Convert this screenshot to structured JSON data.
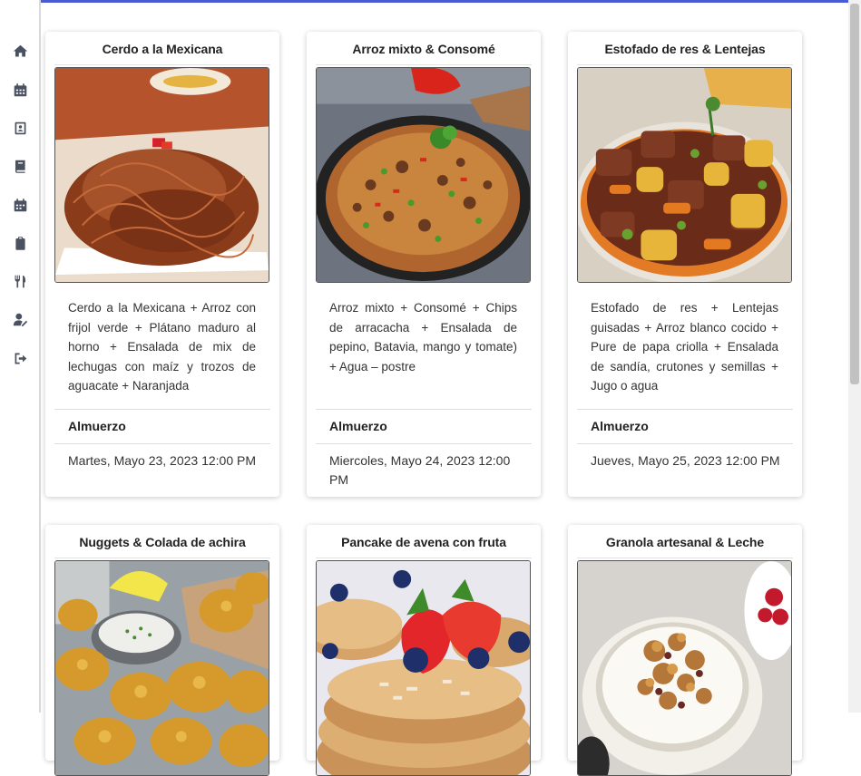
{
  "sidebar": {
    "items": [
      {
        "name": "home-icon"
      },
      {
        "name": "calendar-icon"
      },
      {
        "name": "contact-book-icon"
      },
      {
        "name": "book-icon"
      },
      {
        "name": "calendar-alt-icon"
      },
      {
        "name": "clipboard-icon"
      },
      {
        "name": "utensils-icon"
      },
      {
        "name": "user-edit-icon"
      },
      {
        "name": "sign-out-icon"
      }
    ]
  },
  "colors": {
    "accent": "#4a5bd6",
    "icon": "#4a5160"
  },
  "cards": [
    {
      "title": "Cerdo a la Mexicana",
      "image": "shredded-pork-dish",
      "description": "Cerdo a la Mexicana + Arroz con frijol verde + Plátano maduro al horno + Ensalada de mix de lechugas con maíz y trozos de aguacate + Naranjada",
      "meal": "Almuerzo",
      "date": "Martes, Mayo 23, 2023 12:00 PM"
    },
    {
      "title": "Arroz mixto & Consomé",
      "image": "mixed-rice-pan",
      "description": "Arroz mixto + Consomé + Chips de arracacha + Ensalada de pepino, Batavia, mango y tomate) + Agua – postre",
      "meal": "Almuerzo",
      "date": "Miercoles, Mayo 24, 2023 12:00 PM"
    },
    {
      "title": "Estofado de res & Lentejas",
      "image": "beef-stew-bowl",
      "description": "Estofado de res + Lentejas guisadas + Arroz blanco cocido + Pure de papa criolla + Ensalada de sandía, crutones y semillas + Jugo o agua",
      "meal": "Almuerzo",
      "date": "Jueves, Mayo 25, 2023 12:00 PM"
    },
    {
      "title": "Nuggets & Colada de achira",
      "image": "nuggets-plate"
    },
    {
      "title": "Pancake de avena con fruta",
      "image": "pancakes-strawberries"
    },
    {
      "title": "Granola artesanal & Leche",
      "image": "granola-bowl"
    }
  ]
}
